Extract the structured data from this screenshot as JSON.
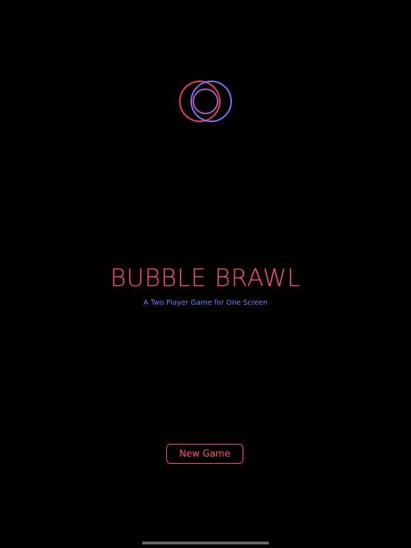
{
  "app": {
    "title": "BUBBLE BRAWL",
    "subtitle": "A Two Player Game for One Screen"
  },
  "menu": {
    "new_game_label": "New Game"
  },
  "colors": {
    "background": "#000000",
    "accent_pink": "#ff4d77",
    "accent_blue": "#7b7bff"
  },
  "icons": {
    "logo": "overlapping-bubbles-icon"
  }
}
